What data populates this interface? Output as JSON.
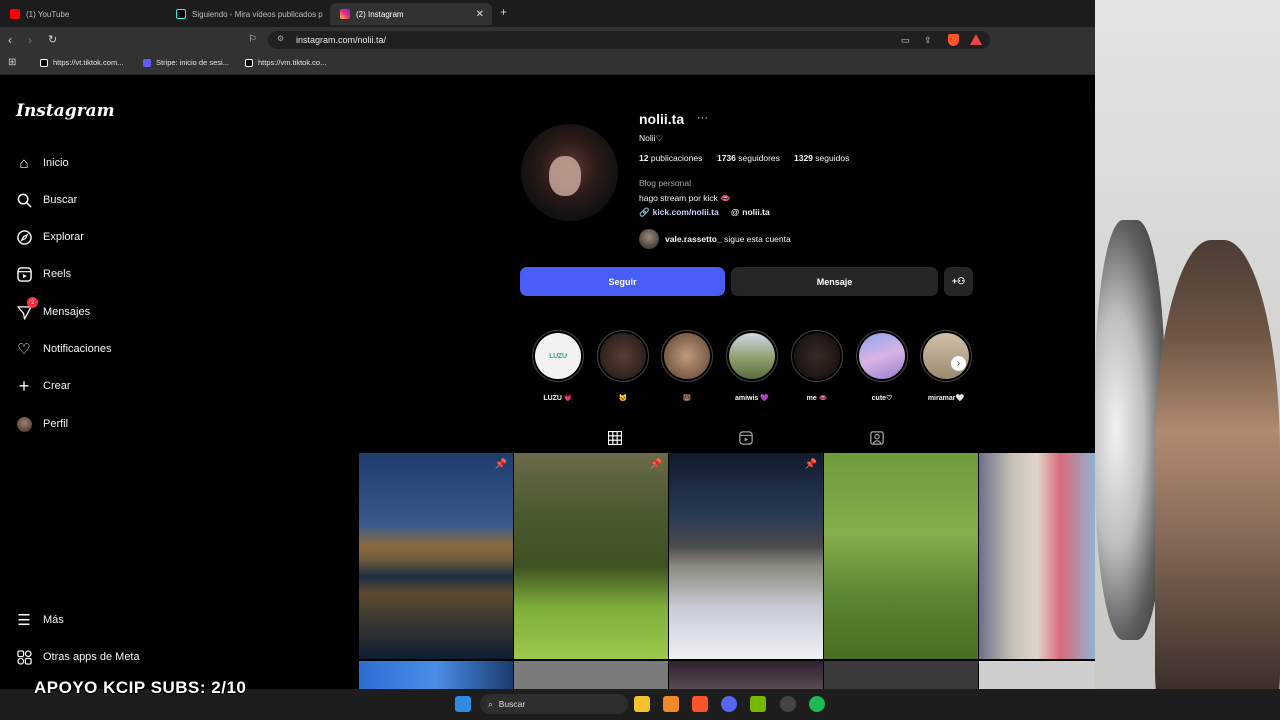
{
  "browser": {
    "tabs": [
      {
        "label": "(1) YouTube",
        "favicon": "youtube-icon"
      },
      {
        "label": "Siguiendo - Mira videos publicados p",
        "favicon": "tiktok-icon"
      },
      {
        "label": "(2) Instagram",
        "favicon": "instagram-icon"
      }
    ],
    "url": "instagram.com/nolii.ta/",
    "bookmarks": [
      {
        "label": "https://vt.tiktok.com...",
        "icon": "tiktok-icon"
      },
      {
        "label": "Stripe: inicio de sesi...",
        "icon": "stripe-icon"
      },
      {
        "label": "https://vm.tiktok.co...",
        "icon": "tiktok-icon"
      }
    ]
  },
  "sidebar": {
    "logo": "Instagram",
    "items": [
      {
        "label": "Inicio",
        "icon": "home-icon"
      },
      {
        "label": "Buscar",
        "icon": "search-icon"
      },
      {
        "label": "Explorar",
        "icon": "compass-icon"
      },
      {
        "label": "Reels",
        "icon": "reels-icon"
      },
      {
        "label": "Mensajes",
        "icon": "messenger-icon",
        "badge": "2"
      },
      {
        "label": "Notificaciones",
        "icon": "heart-icon"
      },
      {
        "label": "Crear",
        "icon": "plus-icon"
      },
      {
        "label": "Perfil",
        "icon": "avatar-icon"
      }
    ],
    "bottom_items": [
      {
        "label": "Más",
        "icon": "menu-icon"
      },
      {
        "label": "Otras apps de Meta",
        "icon": "meta-apps-icon"
      }
    ]
  },
  "profile": {
    "username": "nolii.ta",
    "name": "Nolii♡",
    "stats": {
      "posts_count": "12",
      "posts_label": "publicaciones",
      "followers_count": "1736",
      "followers_label": "seguidores",
      "following_count": "1329",
      "following_label": "seguidos"
    },
    "category": "Blog personal",
    "bio": "hago stream por kick 👄",
    "link": "kick.com/nolii.ta",
    "threads_handle": "nolii.ta",
    "followed_by_user": "vale.rassetto_",
    "followed_by_text": "sigue esta cuenta",
    "follow_button": "Seguir",
    "message_button": "Mensaje"
  },
  "highlights": [
    {
      "label": "LUZU 💗",
      "color": "#f2f2f2"
    },
    {
      "label": "🐱",
      "color": "#3a2a26"
    },
    {
      "label": "🐻",
      "color": "#8b6b55"
    },
    {
      "label": "amiwis 💜",
      "color": "#7d8a66"
    },
    {
      "label": "me 👄",
      "color": "#1e1614"
    },
    {
      "label": "cute♡",
      "color": "#b7a3e0"
    },
    {
      "label": "miramar🤍",
      "color": "#b8a58f"
    }
  ],
  "tabs": [
    {
      "icon": "grid-icon",
      "active": true
    },
    {
      "icon": "reels-tab-icon",
      "active": false
    },
    {
      "icon": "tagged-icon",
      "active": false
    }
  ],
  "overlay": {
    "text": "APOYO KCIP SUBS: 2/10"
  },
  "taskbar": {
    "search_placeholder": "Buscar"
  },
  "colors": {
    "follow_blue": "#4a5df9",
    "secondary_button": "#262626",
    "link_blue": "#e0f1ff"
  }
}
